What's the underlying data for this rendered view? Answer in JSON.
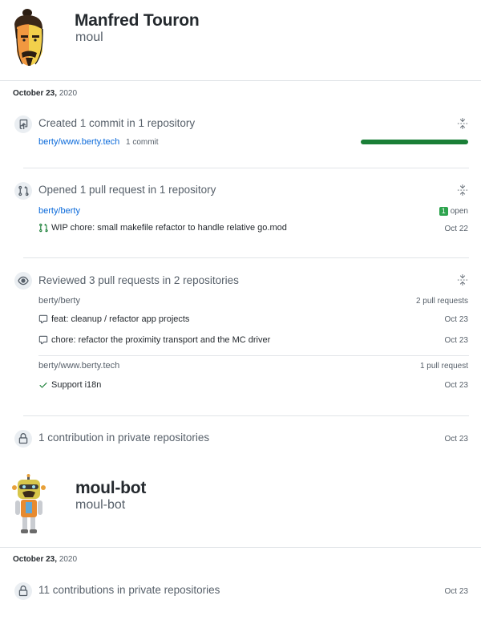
{
  "users": [
    {
      "name": "Manfred Touron",
      "login": "moul",
      "date_bold": "October 23,",
      "date_year": "2020",
      "commits": {
        "heading": "Created 1 commit in 1 repository",
        "repo": "berty/www.berty.tech",
        "count": "1 commit",
        "progress": 1.0
      },
      "pulls": {
        "heading": "Opened 1 pull request in 1 repository",
        "repo": "berty/berty",
        "badge": "1",
        "status": "open",
        "items": [
          {
            "title": "WIP chore: small makefile refactor to handle relative go.mod",
            "date": "Oct 22"
          }
        ]
      },
      "reviews": {
        "heading": "Reviewed 3 pull requests in 2 repositories",
        "groups": [
          {
            "repo": "berty/berty",
            "count": "2 pull requests",
            "items": [
              {
                "title": "feat: cleanup / refactor app projects",
                "date": "Oct 23",
                "icon": "comment-icon"
              },
              {
                "title": "chore: refactor the proximity transport and the MC driver",
                "date": "Oct 23",
                "icon": "comment-icon"
              }
            ]
          },
          {
            "repo": "berty/www.berty.tech",
            "count": "1 pull request",
            "items": [
              {
                "title": "Support i18n",
                "date": "Oct 23",
                "icon": "check-icon"
              }
            ]
          }
        ]
      },
      "private": {
        "heading": "1 contribution in private repositories",
        "date": "Oct 23"
      }
    },
    {
      "name": "moul-bot",
      "login": "moul-bot",
      "date_bold": "October 23,",
      "date_year": "2020",
      "private": {
        "heading": "11 contributions in private repositories",
        "date": "Oct 23"
      }
    }
  ],
  "colors": {
    "accent": "#0969da",
    "success": "#1a7f37",
    "badge": "#2da44e"
  }
}
